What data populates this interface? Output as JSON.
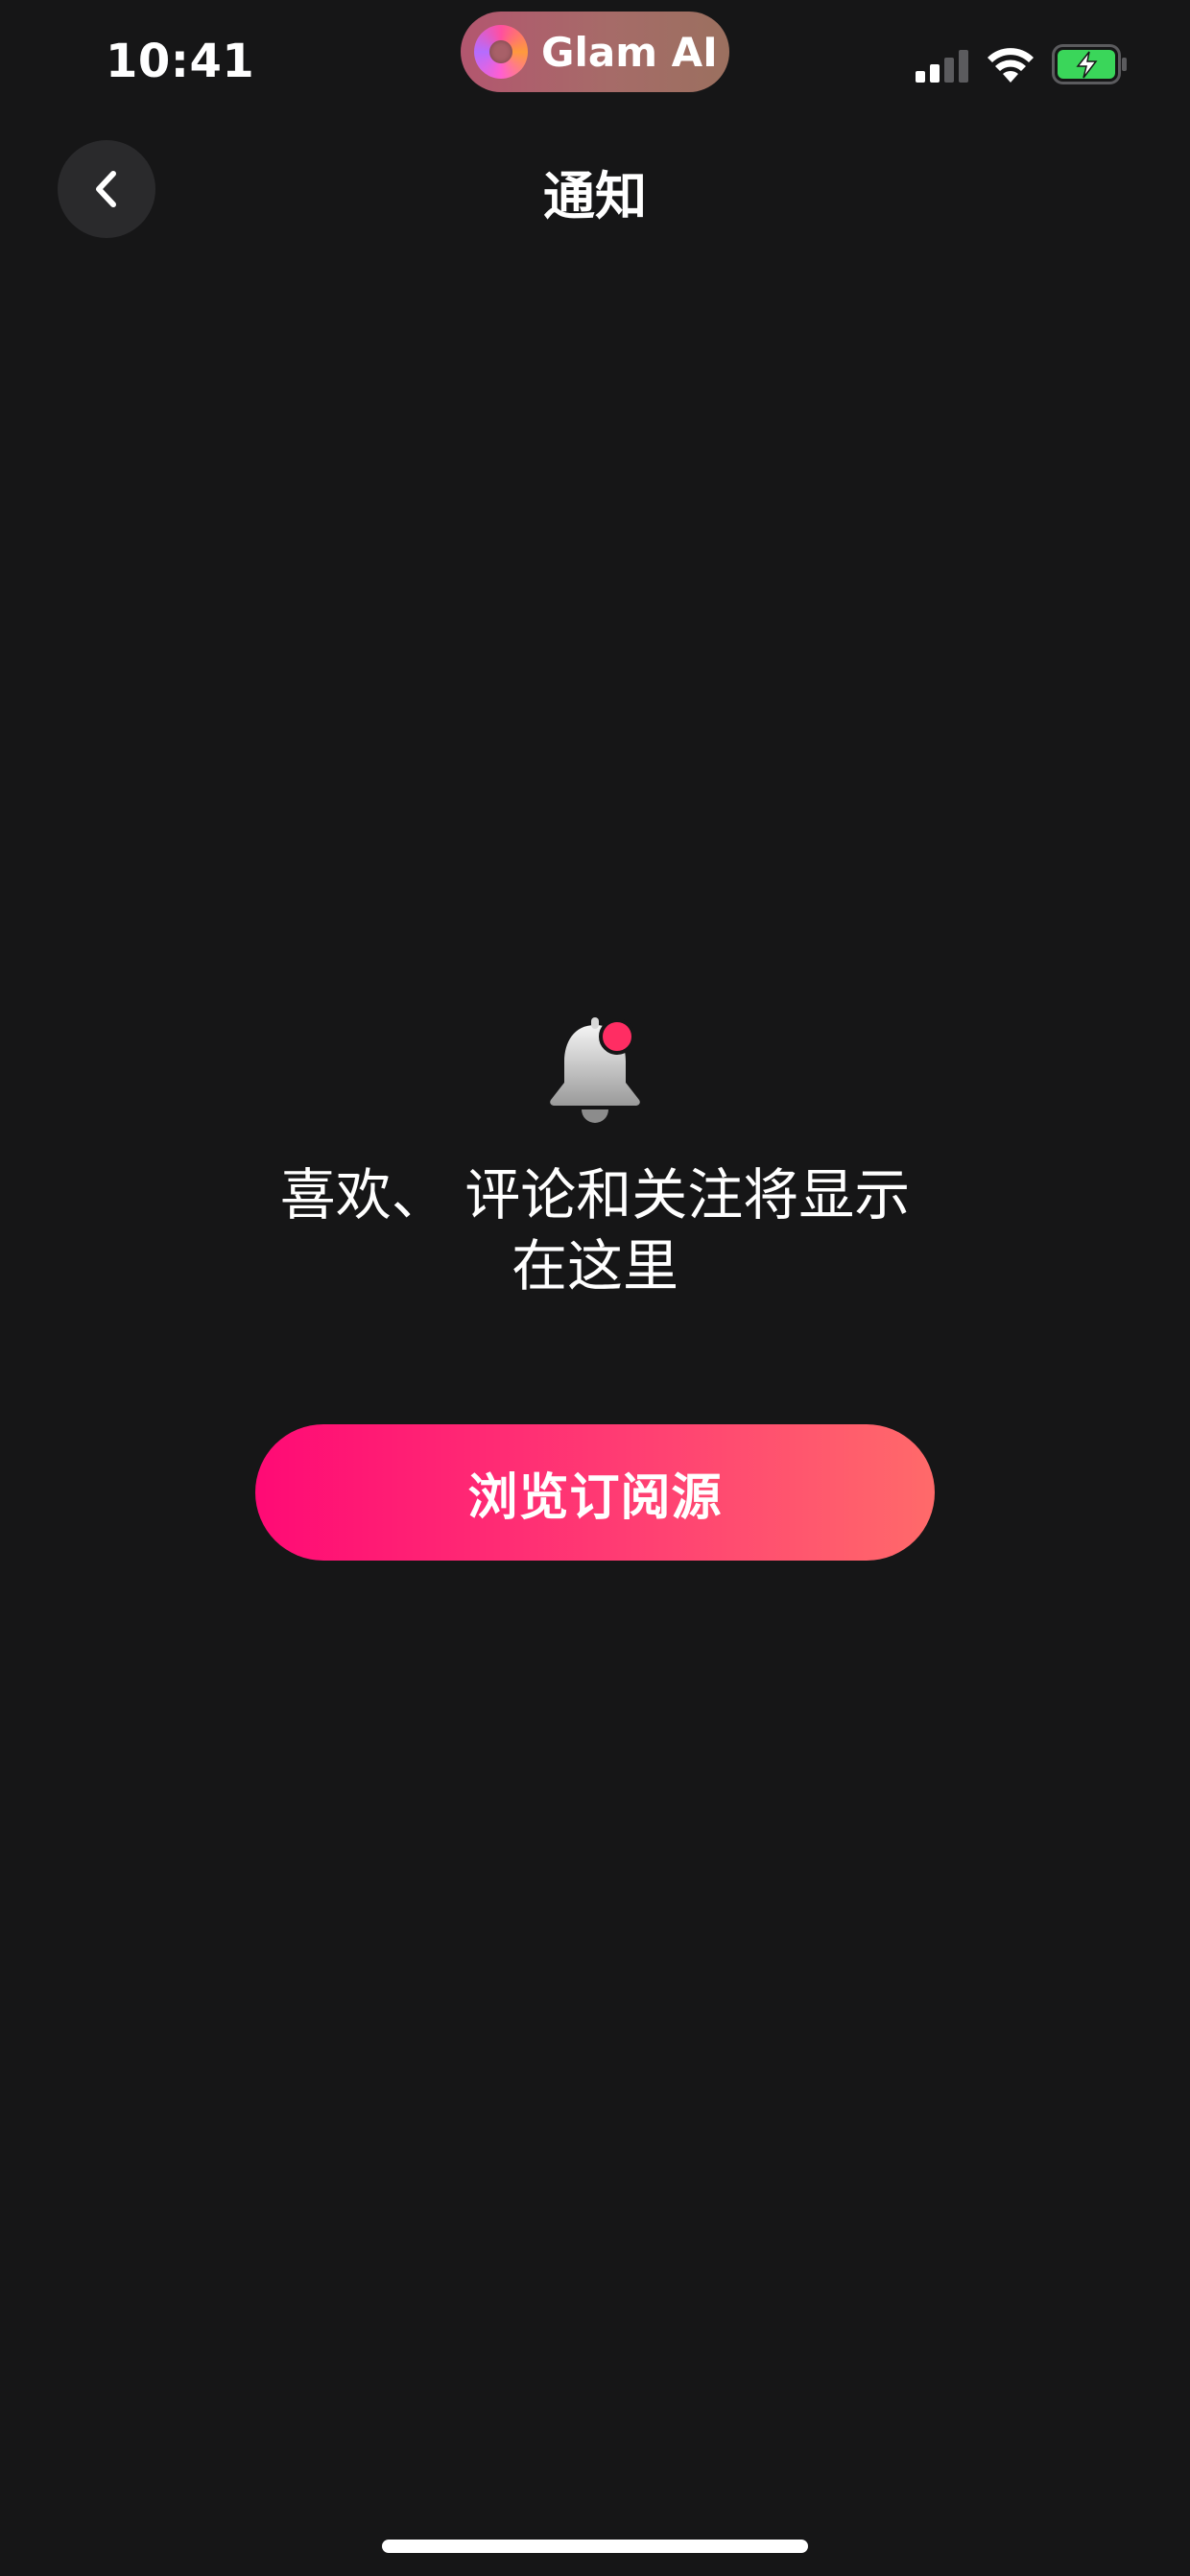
{
  "status_bar": {
    "time": "10:41",
    "island_app_name": "Glam AI",
    "icons": [
      "signal-icon",
      "wifi-icon",
      "battery-charging-icon"
    ]
  },
  "nav": {
    "title": "通知",
    "back_icon": "chevron-left-icon"
  },
  "empty_state": {
    "icon": "bell-icon",
    "message_line1": "喜欢、 评论和关注将显示",
    "message_line2": "在这里",
    "button_label": "浏览订阅源"
  },
  "colors": {
    "background": "#161617",
    "accent_start": "#ff0a75",
    "accent_end": "#ff6a6a",
    "battery_green": "#3ad65a",
    "bell_badge": "#ff2d63"
  }
}
